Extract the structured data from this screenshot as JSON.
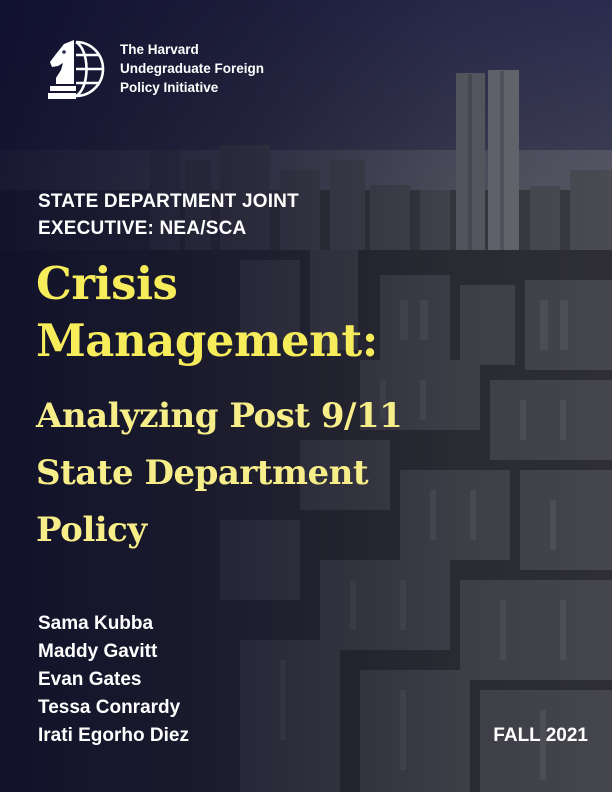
{
  "organization": {
    "name_lines": [
      "The Harvard",
      "Undegraduate Foreign",
      "Policy Initiative"
    ],
    "logo_icon": "knight-globe-icon"
  },
  "kicker_lines": [
    "STATE DEPARTMENT JOINT",
    "EXECUTIVE: NEA/SCA"
  ],
  "title_lines": [
    "Crisis",
    "Management:"
  ],
  "subtitle_lines": [
    "Analyzing Post 9/11",
    "State Department",
    "Policy"
  ],
  "authors": [
    "Sama Kubba",
    "Maddy Gavitt",
    "Evan Gates",
    "Tessa Conrardy",
    "Irati Egorho Diez"
  ],
  "term": "FALL 2021",
  "colors": {
    "title": "#f7ec5a",
    "subtitle": "#f7ee8a",
    "text": "#ffffff",
    "overlay": "#1a1a3a"
  },
  "background_image": "new-york-skyline-photo"
}
